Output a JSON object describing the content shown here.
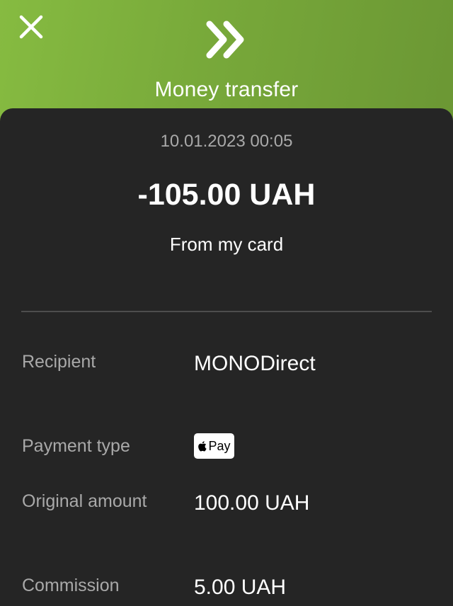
{
  "header": {
    "title": "Money transfer",
    "logo_icon": "double-chevron-right-icon",
    "close_icon": "close-icon",
    "gradient_start": "#86bb41",
    "gradient_end": "#6b9734"
  },
  "transaction": {
    "datetime": "10.01.2023 00:05",
    "amount": "-105.00 UAH",
    "source": "From my card"
  },
  "details": {
    "recipient_label": "Recipient",
    "recipient_value": "MONODirect",
    "payment_type_label": "Payment type",
    "payment_type_badge_text": "Pay",
    "payment_type_icon": "apple-pay-icon",
    "original_amount_label": "Original amount",
    "original_amount_value": "100.00 UAH",
    "commission_label": "Commission",
    "commission_value": "5.00 UAH"
  }
}
